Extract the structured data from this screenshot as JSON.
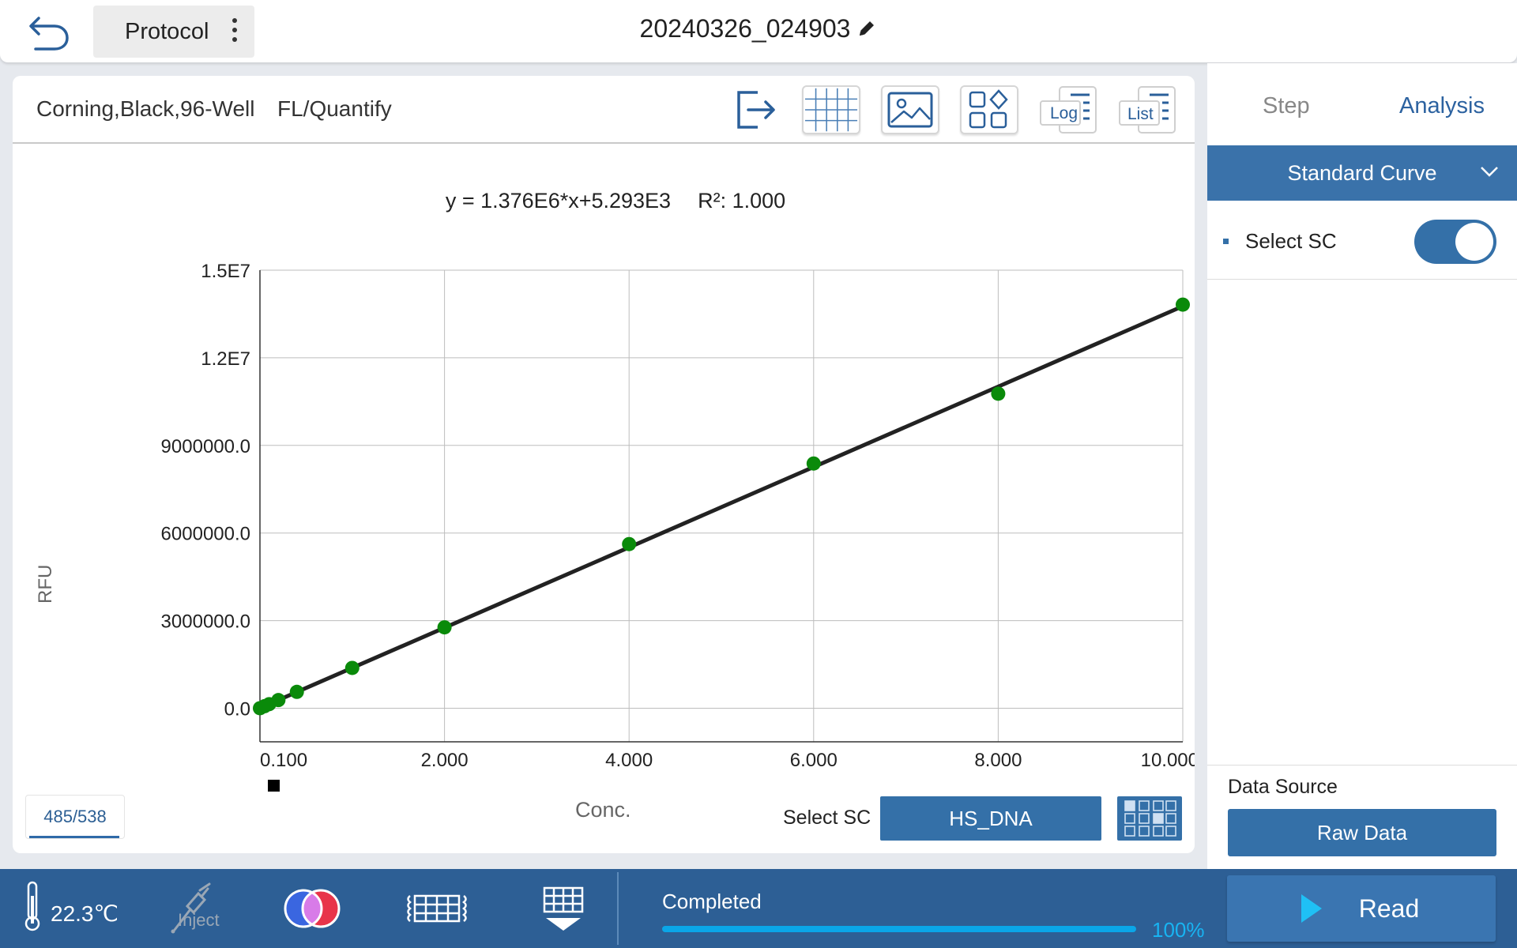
{
  "header": {
    "protocol_label": "Protocol",
    "title": "20240326_024903"
  },
  "card": {
    "plate": "Corning,Black,96-Well",
    "mode": "FL/Quantify",
    "toolbar": {
      "log_label": "Log",
      "list_label": "List"
    }
  },
  "equation": {
    "formula": "y = 1.376E6*x+5.293E3",
    "r2": "R²: 1.000"
  },
  "chart_data": {
    "type": "scatter",
    "xlabel": "Conc.",
    "ylabel": "RFU",
    "xlim": [
      0,
      10
    ],
    "ylim": [
      -1150000,
      15000000
    ],
    "x_tick_values": [
      0,
      2,
      4,
      6,
      8,
      10
    ],
    "x_ticks": [
      "0.100",
      "2.000",
      "4.000",
      "6.000",
      "8.000",
      "10.000"
    ],
    "y_tick_values": [
      0,
      3000000,
      6000000,
      9000000,
      12000000,
      15000000
    ],
    "y_ticks": [
      "0.0",
      "3000000.0",
      "6000000.0",
      "9000000.0",
      "1.2E7",
      "1.5E7"
    ],
    "grid": true,
    "fit": {
      "slope": 1376000,
      "intercept": 5293
    },
    "points": [
      [
        0.0,
        0
      ],
      [
        0.05,
        70000
      ],
      [
        0.1,
        140000
      ],
      [
        0.2,
        280000
      ],
      [
        0.4,
        560000
      ],
      [
        1.0,
        1380000
      ],
      [
        2.0,
        2770000
      ],
      [
        4.0,
        5620000
      ],
      [
        6.0,
        8380000
      ],
      [
        8.0,
        10770000
      ],
      [
        10.0,
        13820000
      ]
    ]
  },
  "bottom_controls": {
    "wavelength": "485/538",
    "select_sc_label": "Select SC",
    "select_sc_value": "HS_DNA"
  },
  "panel": {
    "tabs": [
      "Step",
      "Analysis"
    ],
    "section_title": "Standard Curve",
    "select_sc_label": "Select SC",
    "select_sc_enabled": true,
    "data_source_label": "Data Source",
    "data_source_value": "Raw Data"
  },
  "status_bar": {
    "temperature": "22.3℃",
    "inject_label": "Inject",
    "status": "Completed",
    "progress_percent": 100,
    "progress_label": "100%",
    "read_label": "Read"
  },
  "colors": {
    "accent": "#3470a8",
    "point": "#0a8a0a",
    "bar": "#2d5f95"
  }
}
